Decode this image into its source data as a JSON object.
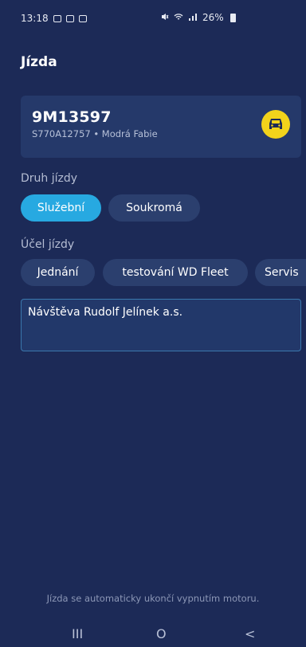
{
  "status_bar": {
    "time": "13:18",
    "left_icons": [
      "message-icon",
      "shield-icon",
      "gallery-icon"
    ],
    "right_icons": [
      "mute-icon",
      "wifi-icon",
      "signal-icon"
    ],
    "battery": "26%"
  },
  "header": {
    "title": "Jízda"
  },
  "vehicle": {
    "plate": "9M13597",
    "subtitle": "S770A12757 • Modrá Fabie",
    "icon": "car-icon",
    "badge_color": "#f2d31b"
  },
  "trip_type": {
    "label": "Druh jízdy",
    "options": [
      "Služební",
      "Soukromá"
    ],
    "selected": "Služební"
  },
  "purpose": {
    "label": "Účel jízdy",
    "options": [
      "Jednání",
      "testování WD Fleet",
      "Servis"
    ],
    "value": "Návštěva Rudolf Jelínek a.s."
  },
  "footer": {
    "note": "Jízda se automaticky ukončí vypnutím motoru."
  },
  "nav": {
    "recent": "III",
    "home": "O",
    "back": "<"
  },
  "colors": {
    "background": "#1c2a57",
    "card": "#25396a",
    "accent": "#27a9e1",
    "chip": "#2b3f6e"
  }
}
